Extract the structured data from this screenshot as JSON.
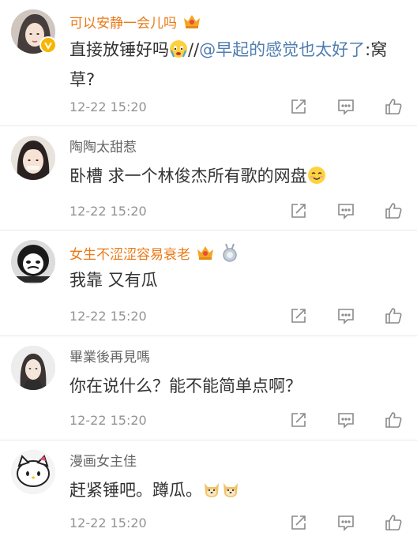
{
  "comments": [
    {
      "username": "可以安静一会儿吗",
      "text_before": "直接放锤好吗",
      "text_separator": "//",
      "mention": "@早起的感觉也太好了",
      "text_after": ":窝草?",
      "timestamp": "12-22 15:20"
    },
    {
      "username": "陶陶太甜惹",
      "text": "卧槽 求一个林俊杰所有歌的网盘",
      "timestamp": "12-22 15:20"
    },
    {
      "username": "女生不涩涩容易衰老",
      "text": "我靠 又有瓜",
      "timestamp": "12-22 15:20"
    },
    {
      "username": "畢業後再見嗎",
      "text": "你在说什么？能不能简单点啊？",
      "timestamp": "12-22 15:20"
    },
    {
      "username": "漫画女主佳",
      "text": "赶紧锤吧。蹲瓜。",
      "timestamp": "12-22 15:20"
    }
  ],
  "colors": {
    "vip_name": "#ea7a18",
    "normal_name": "#666666",
    "mention": "#507daf",
    "timestamp": "#939393"
  },
  "icons": [
    "share-icon",
    "comment-icon",
    "like-icon",
    "crown-badge-icon",
    "medal-badge-icon",
    "verified-badge-icon"
  ]
}
